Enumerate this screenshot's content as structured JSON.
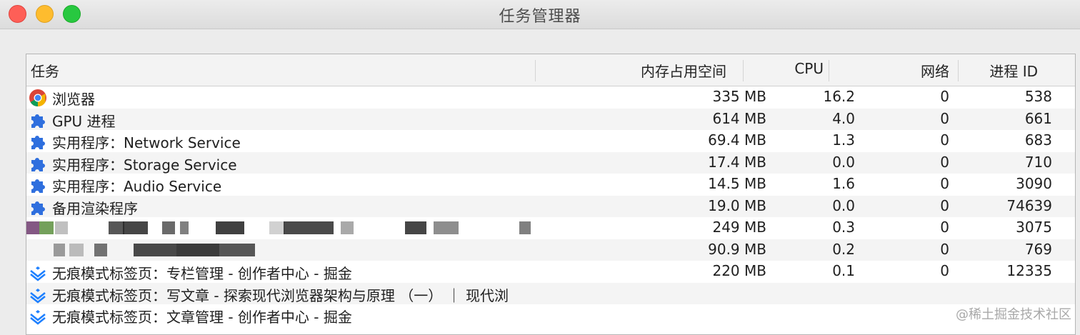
{
  "window": {
    "title": "任务管理器"
  },
  "table": {
    "columns": [
      "任务",
      "内存占用空间",
      "CPU",
      "网络",
      "进程 ID"
    ],
    "rows": [
      {
        "icon": "chrome-icon",
        "name": "浏览器",
        "memory": "335 MB",
        "cpu": "16.2",
        "network": "0",
        "pid": "538"
      },
      {
        "icon": "puzzle-icon",
        "name": "GPU 进程",
        "memory": "614 MB",
        "cpu": "4.0",
        "network": "0",
        "pid": "661"
      },
      {
        "icon": "puzzle-icon",
        "name": "实用程序：Network Service",
        "memory": "69.4 MB",
        "cpu": "1.3",
        "network": "0",
        "pid": "683"
      },
      {
        "icon": "puzzle-icon",
        "name": "实用程序：Storage Service",
        "memory": "17.4 MB",
        "cpu": "0.0",
        "network": "0",
        "pid": "710"
      },
      {
        "icon": "puzzle-icon",
        "name": "实用程序：Audio Service",
        "memory": "14.5 MB",
        "cpu": "1.6",
        "network": "0",
        "pid": "3090"
      },
      {
        "icon": "puzzle-icon",
        "name": "备用渲染程序",
        "memory": "19.0 MB",
        "cpu": "0.0",
        "network": "0",
        "pid": "74639"
      },
      {
        "icon": "redacted",
        "name": "",
        "memory": "249 MB",
        "cpu": "0.3",
        "network": "0",
        "pid": "3075"
      },
      {
        "icon": "redacted",
        "name": "",
        "memory": "90.9 MB",
        "cpu": "0.2",
        "network": "0",
        "pid": "769"
      },
      {
        "icon": "juejin-icon",
        "name": "无痕模式标签页：专栏管理 - 创作者中心 - 掘金",
        "memory": "220 MB",
        "cpu": "0.1",
        "network": "0",
        "pid": "12335"
      },
      {
        "icon": "juejin-icon",
        "name": "无痕模式标签页：写文章 - 探索现代浏览器架构与原理 （一） ｜ 现代浏",
        "memory": "",
        "cpu": "",
        "network": "",
        "pid": ""
      },
      {
        "icon": "juejin-icon",
        "name": "无痕模式标签页：文章管理 - 创作者中心 - 掘金",
        "memory": "",
        "cpu": "",
        "network": "",
        "pid": ""
      }
    ]
  },
  "watermark": "@稀土掘金技术社区",
  "colors": {
    "accent_blue": "#2f6fde",
    "juejin_blue": "#1e80ff"
  }
}
